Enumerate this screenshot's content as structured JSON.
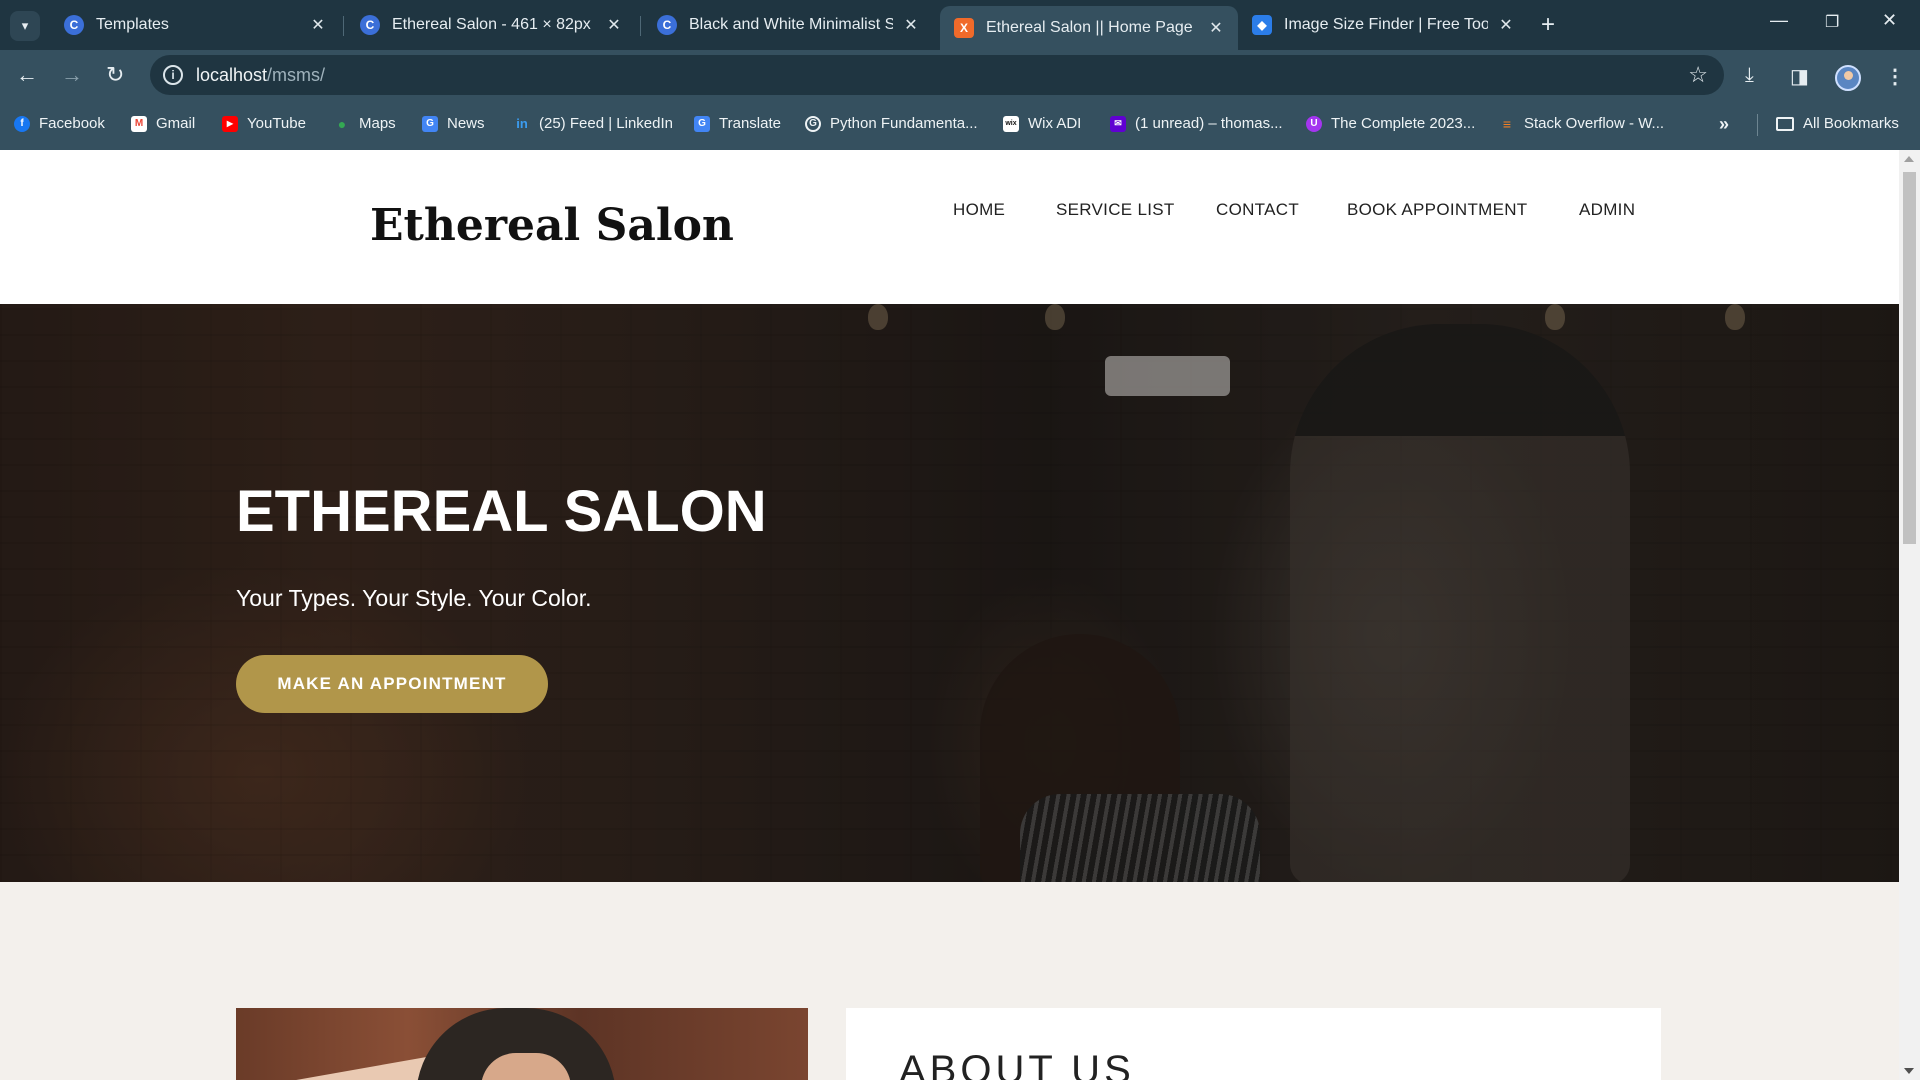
{
  "browser": {
    "tabs": [
      {
        "title": "Templates",
        "favicon_color": "#3b6fd8",
        "favicon_letter": "C"
      },
      {
        "title": "Ethereal Salon - 461 × 82px",
        "favicon_color": "#3b6fd8",
        "favicon_letter": "C"
      },
      {
        "title": "Black and White Minimalist Sim",
        "favicon_color": "#3b6fd8",
        "favicon_letter": "C"
      },
      {
        "title": "Ethereal Salon || Home Page",
        "favicon_color": "#f06a2a",
        "favicon_letter": "X",
        "active": true
      },
      {
        "title": "Image Size Finder | Free Tool | P",
        "favicon_color": "#2b7de9",
        "favicon_letter": "◆"
      }
    ],
    "address": {
      "host": "localhost",
      "path": "/msms/"
    },
    "bookmarks": [
      {
        "label": "Facebook",
        "icon": "facebook-icon",
        "color": "#1877f2",
        "glyph": "f"
      },
      {
        "label": "Gmail",
        "icon": "gmail-icon",
        "color": "#ea4335",
        "glyph": "M"
      },
      {
        "label": "YouTube",
        "icon": "youtube-icon",
        "color": "#ff0000",
        "glyph": "▶"
      },
      {
        "label": "Maps",
        "icon": "maps-icon",
        "color": "#34a853",
        "glyph": "●"
      },
      {
        "label": "News",
        "icon": "news-icon",
        "color": "#4285f4",
        "glyph": "G"
      },
      {
        "label": "(25) Feed | LinkedIn",
        "icon": "linkedin-icon",
        "color": "#0a66c2",
        "glyph": "in"
      },
      {
        "label": "Translate",
        "icon": "translate-icon",
        "color": "#4285f4",
        "glyph": "G"
      },
      {
        "label": "Python Fundamenta...",
        "icon": "google-icon",
        "color": "#4a6470",
        "glyph": "G"
      },
      {
        "label": "Wix ADI",
        "icon": "wix-icon",
        "color": "#111111",
        "glyph": "wix"
      },
      {
        "label": "(1 unread) – thomas...",
        "icon": "yahoo-mail-icon",
        "color": "#6001d2",
        "glyph": "✉"
      },
      {
        "label": "The Complete 2023...",
        "icon": "udemy-icon",
        "color": "#a435f0",
        "glyph": "U"
      },
      {
        "label": "Stack Overflow - W...",
        "icon": "stackoverflow-icon",
        "color": "#f48024",
        "glyph": "≡"
      }
    ],
    "all_bookmarks": "All Bookmarks"
  },
  "site": {
    "logo": "Ethereal Salon",
    "nav": [
      "HOME",
      "SERVICE LIST",
      "CONTACT",
      "BOOK APPOINTMENT",
      "ADMIN"
    ],
    "hero": {
      "title": "ETHEREAL SALON",
      "subtitle": "Your Types. Your Style. Your Color.",
      "cta": "MAKE AN APPOINTMENT"
    },
    "about_title": "ABOUT US",
    "colors": {
      "accent": "#b1964a",
      "section_bg": "#f3f0ec"
    }
  }
}
